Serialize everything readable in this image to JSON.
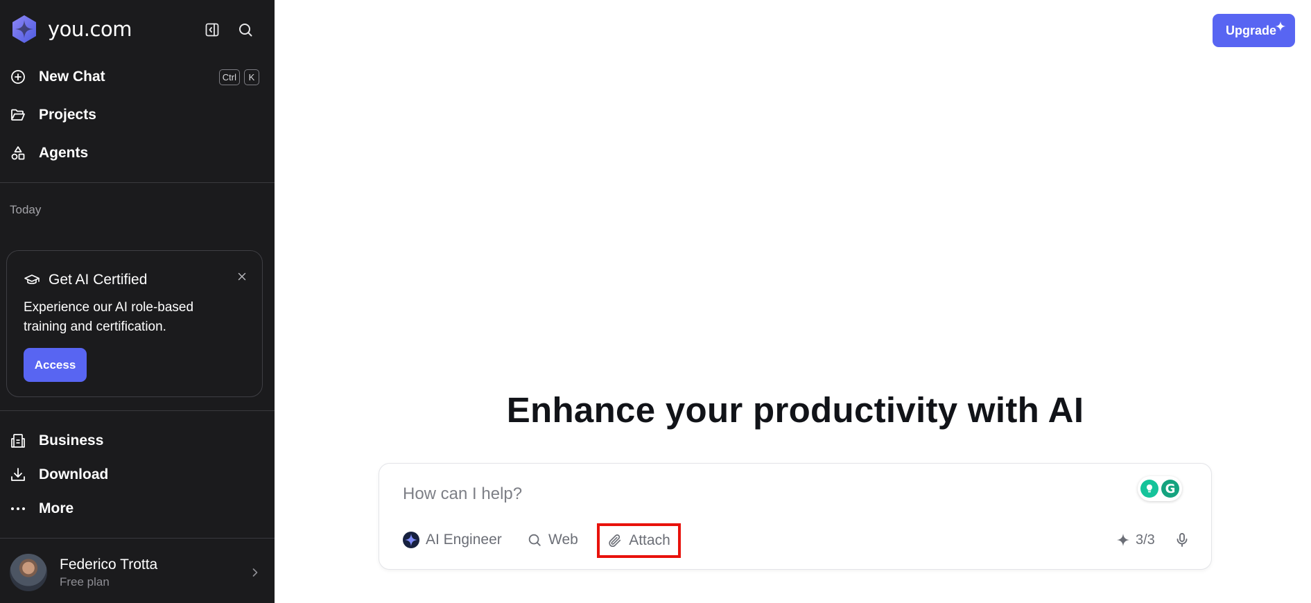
{
  "brand": {
    "name": "you.com",
    "logo_icon": "you-logo-icon"
  },
  "sidebar": {
    "nav": [
      {
        "label": "New Chat",
        "icon": "plus-circle-icon",
        "shortcut": [
          "Ctrl",
          "K"
        ]
      },
      {
        "label": "Projects",
        "icon": "folder-icon"
      },
      {
        "label": "Agents",
        "icon": "shapes-icon"
      }
    ],
    "section_label": "Today",
    "promo": {
      "title": "Get AI Certified",
      "icon": "graduation-cap-icon",
      "text": "Experience our AI role-based training and certification.",
      "button": "Access"
    },
    "footer_nav": [
      {
        "label": "Business",
        "icon": "building-icon"
      },
      {
        "label": "Download",
        "icon": "download-icon"
      },
      {
        "label": "More",
        "icon": "more-dots-icon"
      }
    ],
    "user": {
      "name": "Federico Trotta",
      "plan": "Free plan"
    }
  },
  "header": {
    "upgrade_label": "Upgrade"
  },
  "main": {
    "headline": "Enhance your productivity with AI",
    "composer": {
      "placeholder": "How can I help?",
      "agent_label": "AI Engineer",
      "web_label": "Web",
      "attach_label": "Attach",
      "counter": "3/3"
    }
  },
  "colors": {
    "sidebar_bg": "#1b1b1d",
    "accent": "#5865f2",
    "highlight": "#e8120c"
  }
}
